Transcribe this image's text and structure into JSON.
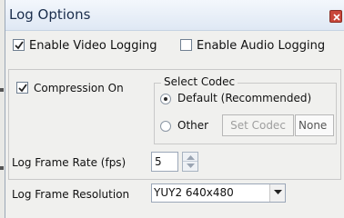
{
  "window": {
    "title": "Log Options"
  },
  "logging": {
    "video_label": "Enable Video Logging",
    "video_checked": true,
    "audio_label": "Enable Audio Logging",
    "audio_checked": false
  },
  "compression": {
    "label": "Compression On",
    "checked": true
  },
  "codec": {
    "group_title": "Select Codec",
    "default_label": "Default (Recommended)",
    "other_label": "Other",
    "selected": "Default (Recommended)",
    "set_codec_label": "Set Codec",
    "codec_value": "None"
  },
  "frame_rate": {
    "label": "Log Frame Rate (fps)",
    "value": "5"
  },
  "resolution": {
    "label": "Log Frame Resolution",
    "value": "YUY2 640x480"
  }
}
